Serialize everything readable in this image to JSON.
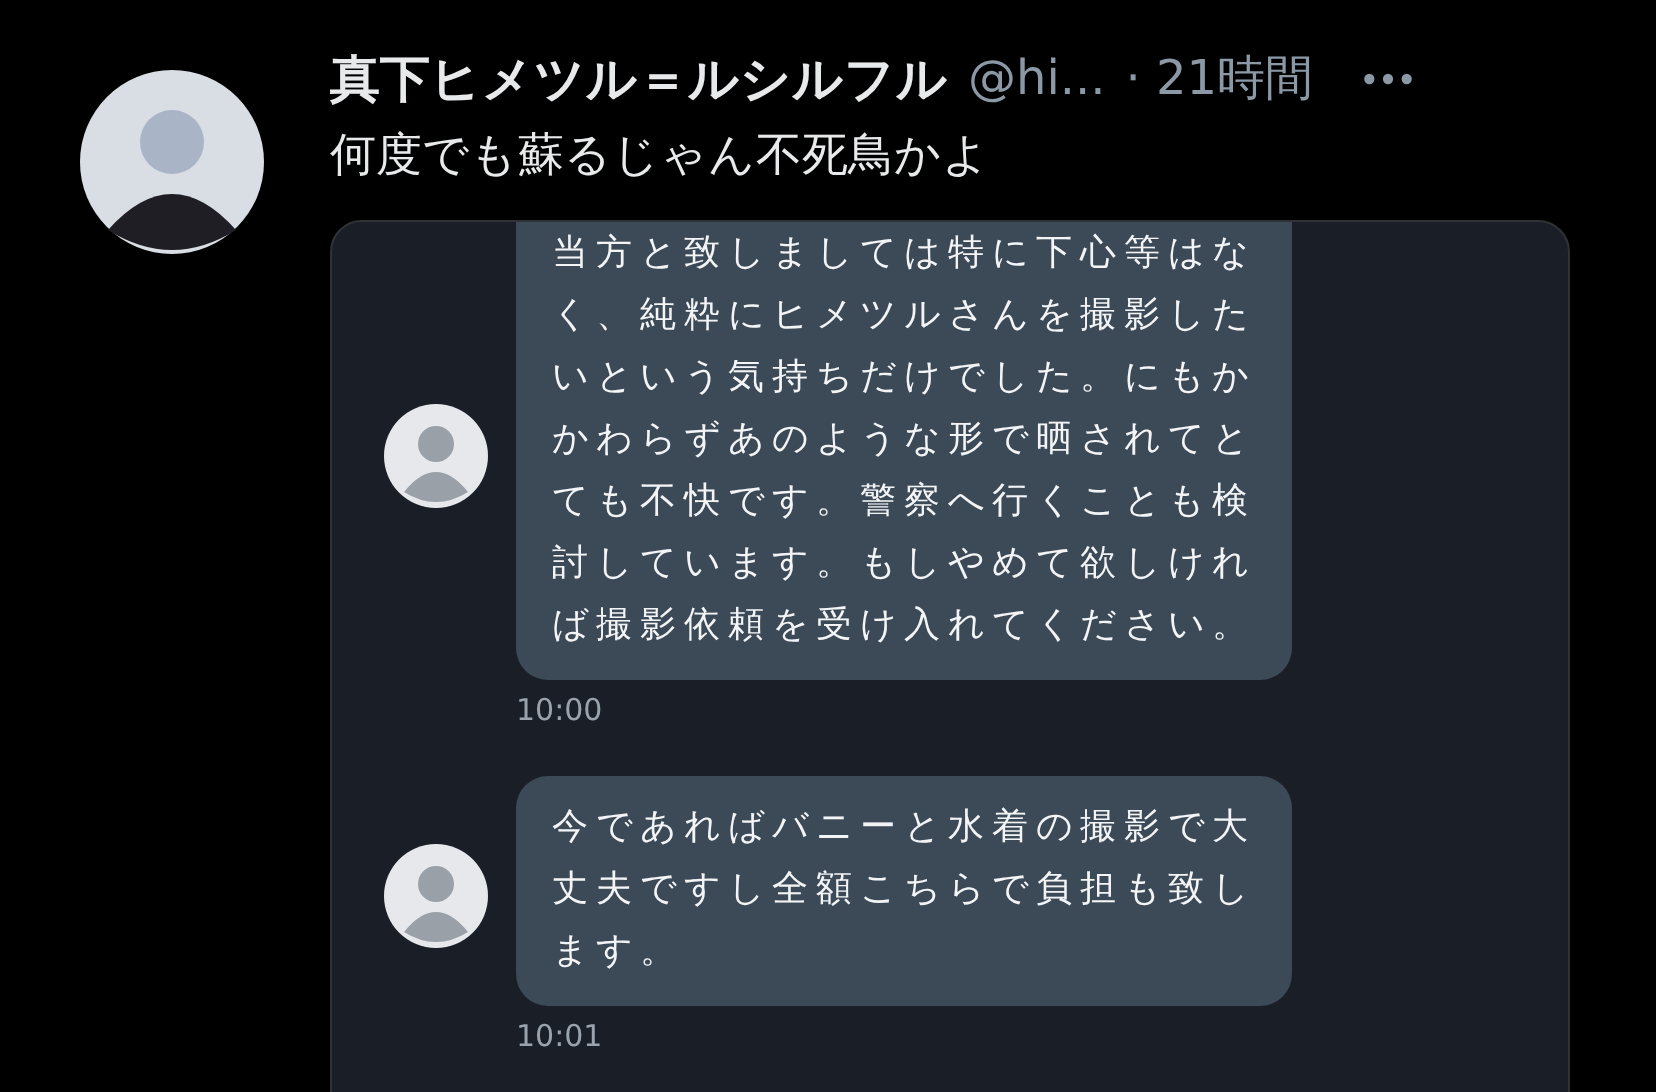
{
  "tweet": {
    "author_name": "真下ヒメツル＝ルシルフル",
    "handle": "@hi...",
    "time": "· 21時間",
    "text": "何度でも蘇るじゃん不死鳥かよ"
  },
  "attached_image": {
    "messages": [
      {
        "text": "当方と致しましては特に下心等はなく、純粋にヒメツルさんを撮影したいという気持ちだけでした。にもかかわらずあのような形で晒されてとても不快です。警察へ行くことも検討しています。もしやめて欲しければ撮影依頼を受け入れてください。",
        "time": "10:00"
      },
      {
        "text": "今であればバニーと水着の撮影で大丈夫ですし全額こちらで負担も致します。",
        "time": "10:01"
      }
    ]
  }
}
